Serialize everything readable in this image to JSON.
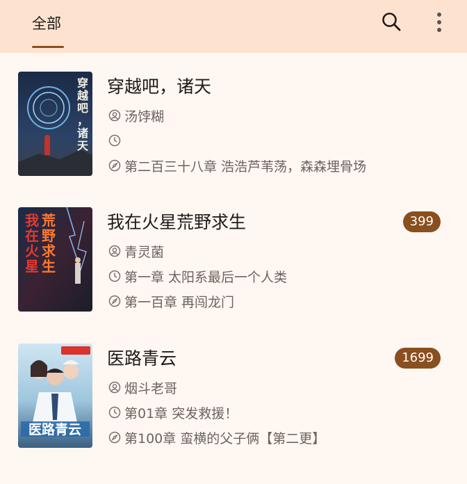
{
  "header": {
    "tab_label": "全部"
  },
  "books": [
    {
      "title": "穿越吧，诸天",
      "author": "汤饽糊",
      "last_read": "",
      "latest_chapter": "第二百三十八章 浩浩芦苇荡，森森埋骨场",
      "unread_count": "",
      "cover_text": "穿越吧，诸天"
    },
    {
      "title": "我在火星荒野求生",
      "author": "青灵菌",
      "last_read": "第一章 太阳系最后一个人类",
      "latest_chapter": "第一百章 再闯龙门",
      "unread_count": "399",
      "cover_text": "我在火星荒野求生"
    },
    {
      "title": "医路青云",
      "author": "烟斗老哥",
      "last_read": "第01章 突发救援！",
      "latest_chapter": "第100章 蛮横的父子俩【第二更】",
      "unread_count": "1699",
      "cover_text": "医路青云"
    }
  ],
  "colors": {
    "header_bg": "#fde3cf",
    "page_bg": "#fff7f2",
    "accent": "#8a4f1e"
  },
  "icons": {
    "author": "person-circle-icon",
    "last_read": "clock-icon",
    "latest_chapter": "compass-icon",
    "search": "search-icon",
    "more": "more-vertical-icon"
  }
}
